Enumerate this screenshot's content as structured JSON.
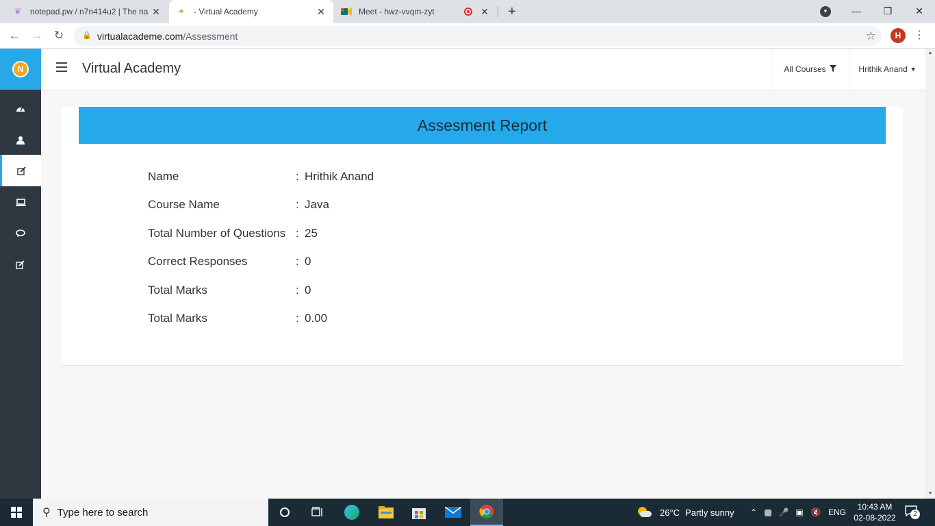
{
  "browser": {
    "tabs": [
      {
        "title": "notepad.pw / n7n414u2 | The na",
        "icon": "notepad-feather-icon"
      },
      {
        "title": "- Virtual Academy",
        "icon": "virtual-academy-icon"
      },
      {
        "title": "Meet - hwz-vvqm-zyt",
        "icon": "google-meet-icon"
      }
    ],
    "url_host": "virtualacademe.com",
    "url_path": "/Assessment",
    "profile_initial": "H"
  },
  "app": {
    "brand": "Virtual Academy",
    "all_courses": "All Courses",
    "user_name": "Hrithik Anand",
    "sidebar_icons": [
      "dashboard-icon",
      "user-icon",
      "edit-icon",
      "laptop-icon",
      "chat-icon",
      "edit-icon"
    ],
    "accent": "#26a9ea",
    "sidebar_color": "#2f3740"
  },
  "report": {
    "title": "Assesment Report",
    "rows": [
      {
        "label": "Name",
        "value": "Hrithik Anand"
      },
      {
        "label": "Course Name",
        "value": "Java"
      },
      {
        "label": "Total Number of Questions",
        "value": "25"
      },
      {
        "label": "Correct Responses",
        "value": "0"
      },
      {
        "label": "Total Marks",
        "value": "0"
      },
      {
        "label": "Total Marks",
        "value": "0.00"
      }
    ],
    "separator": ":"
  },
  "taskbar": {
    "search_placeholder": "Type here to search",
    "weather_temp": "26°C",
    "weather_text": "Partly sunny",
    "language": "ENG",
    "time": "10:43 AM",
    "date": "02-08-2022",
    "notification_count": "2"
  }
}
